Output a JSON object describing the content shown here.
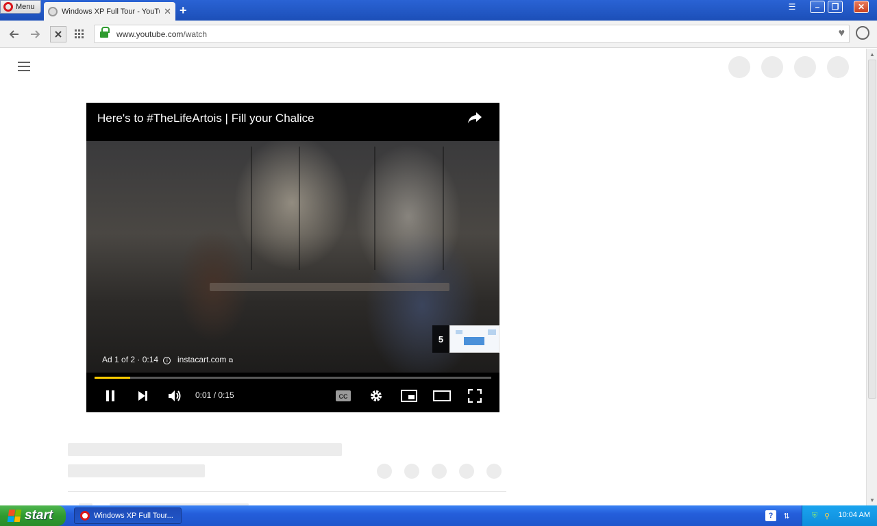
{
  "browser": {
    "menu_label": "Menu",
    "tab_title": "Windows XP Full Tour - YouTube",
    "url_host": "www.youtube.com",
    "url_path": "/watch"
  },
  "video": {
    "title": "Here's to #TheLifeArtois | Fill your Chalice",
    "ad_info": "Ad 1 of 2 · 0:14",
    "ad_link": "instacart.com",
    "skip_countdown": "5",
    "time": "0:01 / 0:15",
    "progress": 0.09,
    "progress_color": "#ffcc00"
  },
  "taskbar": {
    "start_label": "start",
    "task_label": "Windows XP Full Tour...",
    "clock": "10:04 AM"
  },
  "icons": [
    "back-icon",
    "forward-icon",
    "close-icon",
    "speed-dial-icon",
    "lock-icon",
    "heart-icon",
    "account-icon",
    "share-icon",
    "pause-icon",
    "next-icon",
    "volume-icon",
    "cc-icon",
    "settings-icon",
    "miniplayer-icon",
    "theater-icon",
    "fullscreen-icon"
  ]
}
